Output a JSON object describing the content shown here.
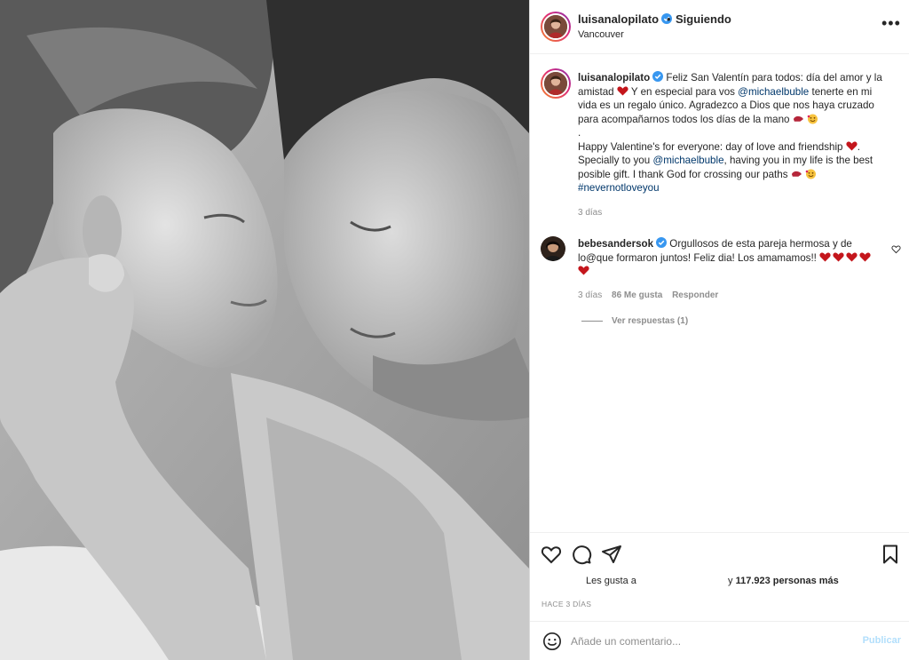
{
  "post": {
    "image_alt": "Foto en blanco y negro de una pareja acostada frente a frente",
    "author": {
      "username": "luisanalopilato",
      "verified": true,
      "follow_separator": "•",
      "follow_status": "Siguiendo",
      "location": "Vancouver"
    },
    "more_label": "•••",
    "caption": {
      "username": "luisanalopilato",
      "p1_a": "Feliz San Valentín para todos: día del amor y la amistad",
      "p1_b": " Y en especial para vos ",
      "mention1": "@michaelbuble",
      "p1_c": " tenerte en mi vida es un regalo único. Agradezco a Dios que nos haya cruzado para acompañarnos todos los días de la mano",
      "dot": ".",
      "p2_a": "Happy Valentine's for everyone: day of love and friendship",
      "p2_b": ". Specially to you ",
      "mention2": "@michaelbuble",
      "p2_c": ", having you in my life is the best posible gift. I thank God for crossing our paths",
      "hashtag": "#nevernotloveyou",
      "time": "3 días"
    },
    "comment": {
      "username": "bebesandersok",
      "verified": true,
      "text": "Orgullosos de esta pareja hermosa y de lo@que formaron juntos! Feliz dia! Los amamamos!!",
      "hearts": 5,
      "time": "3 días",
      "likes": "86 Me gusta",
      "reply": "Responder",
      "view_replies": "Ver respuestas (1)"
    },
    "likes": {
      "prefix": "Les gusta a",
      "and": "y",
      "count": "117.923 personas más"
    },
    "date": "HACE 3 DÍAS",
    "add_comment": {
      "placeholder": "Añade un comentario...",
      "publish": "Publicar"
    }
  },
  "colors": {
    "verified": "#3897f0",
    "heart_red": "#c4161c",
    "mention": "#00376b",
    "muted": "#8e8e8e",
    "publish_disabled": "#b2dffc"
  }
}
